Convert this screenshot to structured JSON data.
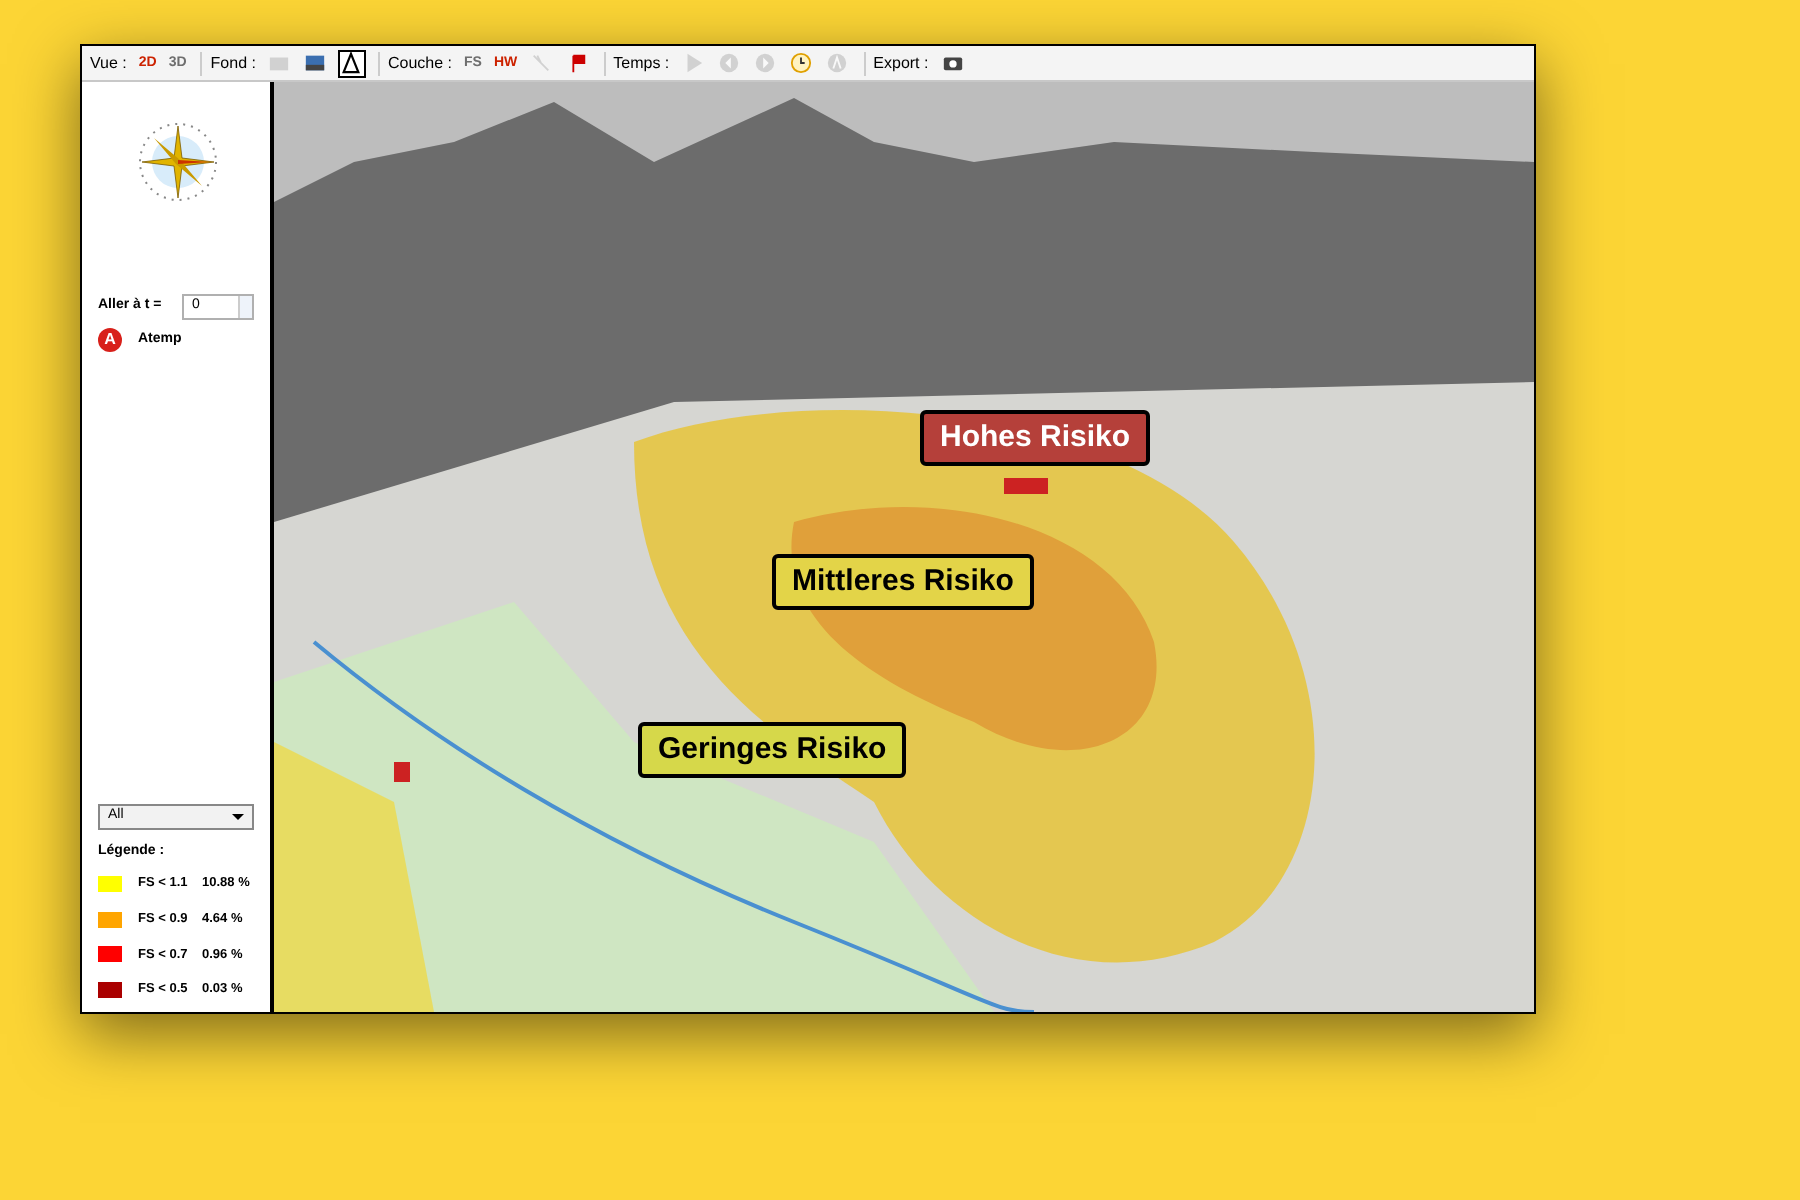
{
  "toolbar": {
    "groups": [
      {
        "label": "Vue :",
        "tools": [
          {
            "kind": "text",
            "text": "2D",
            "selected": false,
            "disabled": false
          },
          {
            "kind": "text",
            "text": "3D",
            "selected": false,
            "disabled": true
          }
        ]
      },
      {
        "label": "Fond :",
        "tools": [
          {
            "kind": "map",
            "selected": false,
            "disabled": true
          },
          {
            "kind": "photo",
            "selected": false,
            "disabled": false
          },
          {
            "kind": "relief",
            "selected": true,
            "disabled": false
          }
        ]
      },
      {
        "label": "Couche :",
        "tools": [
          {
            "kind": "text",
            "text": "FS",
            "selected": false,
            "disabled": true
          },
          {
            "kind": "text",
            "text": "HW",
            "selected": false,
            "disabled": false
          },
          {
            "kind": "line",
            "selected": false,
            "disabled": true
          },
          {
            "kind": "flag",
            "selected": false,
            "disabled": false
          }
        ]
      },
      {
        "label": "Temps :",
        "tools": [
          {
            "kind": "play",
            "selected": false,
            "disabled": true
          },
          {
            "kind": "back",
            "selected": false,
            "disabled": true
          },
          {
            "kind": "forward",
            "selected": false,
            "disabled": true
          },
          {
            "kind": "clock",
            "selected": false,
            "disabled": false
          },
          {
            "kind": "letter",
            "selected": false,
            "disabled": true
          }
        ]
      },
      {
        "label": "Export :",
        "tools": [
          {
            "kind": "camera",
            "selected": false,
            "disabled": false
          }
        ]
      }
    ]
  },
  "sidebar": {
    "goto": {
      "label": "Aller à t =",
      "value": "0"
    },
    "layer": {
      "badge": "A",
      "name": "Atemp"
    },
    "filter": {
      "value": "All"
    },
    "legend": {
      "title": "Légende :",
      "items": [
        {
          "label": "FS < 1.1",
          "value": "10.88 %",
          "color": "#ffff00"
        },
        {
          "label": "FS < 0.9",
          "value": "4.64 %",
          "color": "#ffa500"
        },
        {
          "label": "FS < 0.7",
          "value": "0.96 %",
          "color": "#ff0000"
        },
        {
          "label": "FS < 0.5",
          "value": "0.03 %",
          "color": "#aa0000"
        }
      ]
    }
  },
  "map": {
    "labels": [
      {
        "text": "Hohes Risiko",
        "color": "#b5403a"
      },
      {
        "text": "Mittleres Risiko",
        "color": "#e3d448"
      },
      {
        "text": "Geringes Risiko",
        "color": "#d6d84a"
      }
    ]
  }
}
